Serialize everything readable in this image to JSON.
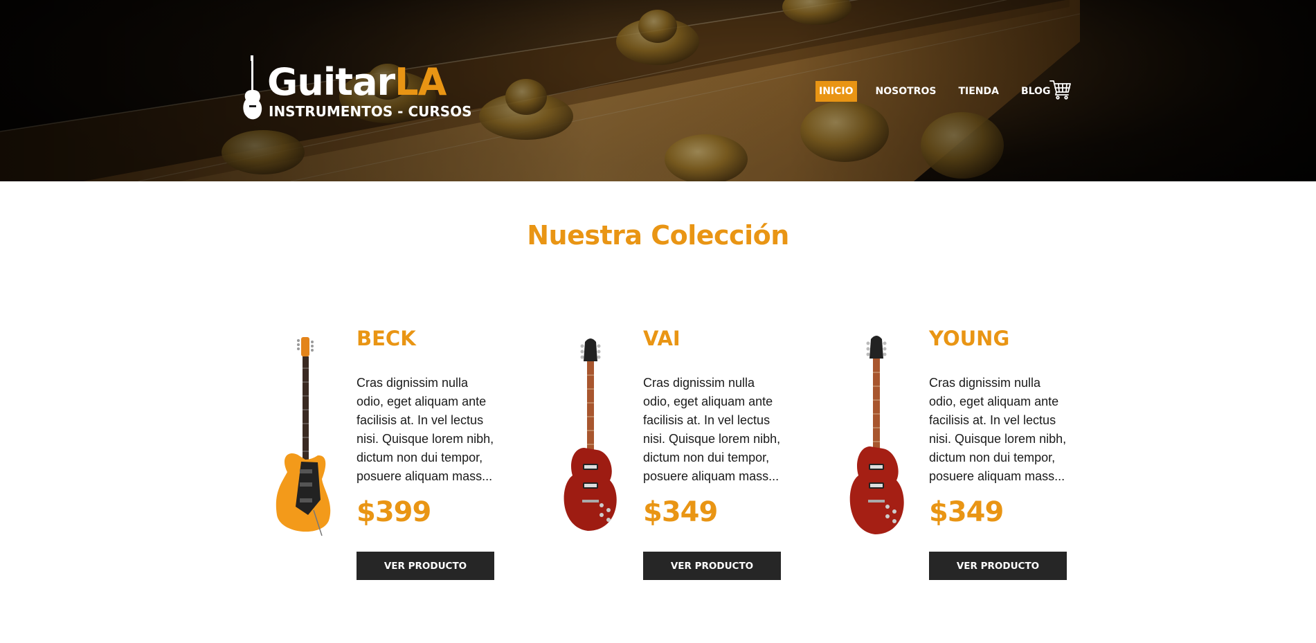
{
  "brand": {
    "name_main": "Guitar",
    "name_accent": "LA",
    "tagline": "INSTRUMENTOS - CURSOS"
  },
  "nav": {
    "items": [
      {
        "label": "INICIO",
        "active": true
      },
      {
        "label": "NOSOTROS",
        "active": false
      },
      {
        "label": "TIENDA",
        "active": false
      },
      {
        "label": "BLOG",
        "active": false
      }
    ],
    "cart_icon": "cart-icon"
  },
  "collection": {
    "title": "Nuestra Colección",
    "products": [
      {
        "name": "BECK",
        "description": "Cras dignissim nulla odio, eget aliquam ante facilisis at. In vel lectus nisi. Quisque lorem nibh, dictum non dui tempor, posuere aliquam mass...",
        "price": "$399",
        "button_label": "VER PRODUCTO",
        "image": "electric-guitar-orange"
      },
      {
        "name": "VAI",
        "description": "Cras dignissim nulla odio, eget aliquam ante facilisis at. In vel lectus nisi. Quisque lorem nibh, dictum non dui tempor, posuere aliquam mass...",
        "price": "$349",
        "button_label": "VER PRODUCTO",
        "image": "les-paul-guitar-red"
      },
      {
        "name": "YOUNG",
        "description": "Cras dignissim nulla odio, eget aliquam ante facilisis at. In vel lectus nisi. Quisque lorem nibh, dictum non dui tempor, posuere aliquam mass...",
        "price": "$349",
        "button_label": "VER PRODUCTO",
        "image": "les-paul-guitar-red"
      }
    ]
  },
  "colors": {
    "accent": "#e99514",
    "button_bg": "#262626",
    "text": "#1a1a1a"
  }
}
